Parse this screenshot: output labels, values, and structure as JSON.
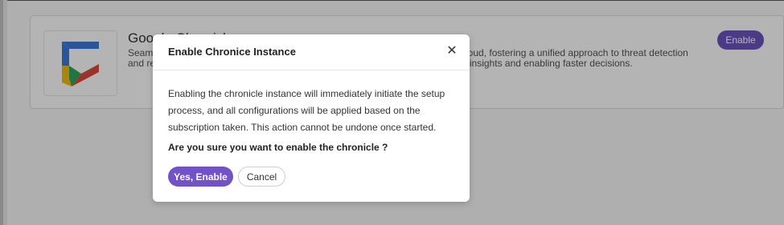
{
  "card": {
    "title": "Google Chronicle",
    "description_left": "Seamlessly integrate Google Chronicle with the Threat Detection Intelligence Cloud, fostering a unified approach to threat detection and response across your environment, empowering users with comprehensive insights and enabling faster decisions.",
    "enable_label": "Enable"
  },
  "modal": {
    "title": "Enable Chronice Instance",
    "close_icon": "close-icon",
    "body": "Enabling the chronicle instance will immediately initiate the setup process, and all configurations will be applied based on the subscription taken. This action cannot be undone once started.",
    "question": "Are you sure you want to enable the chronicle ?",
    "confirm_label": "Yes, Enable",
    "cancel_label": "Cancel"
  },
  "colors": {
    "primary": "#7352c7",
    "enable_button": "#5f45b8"
  }
}
